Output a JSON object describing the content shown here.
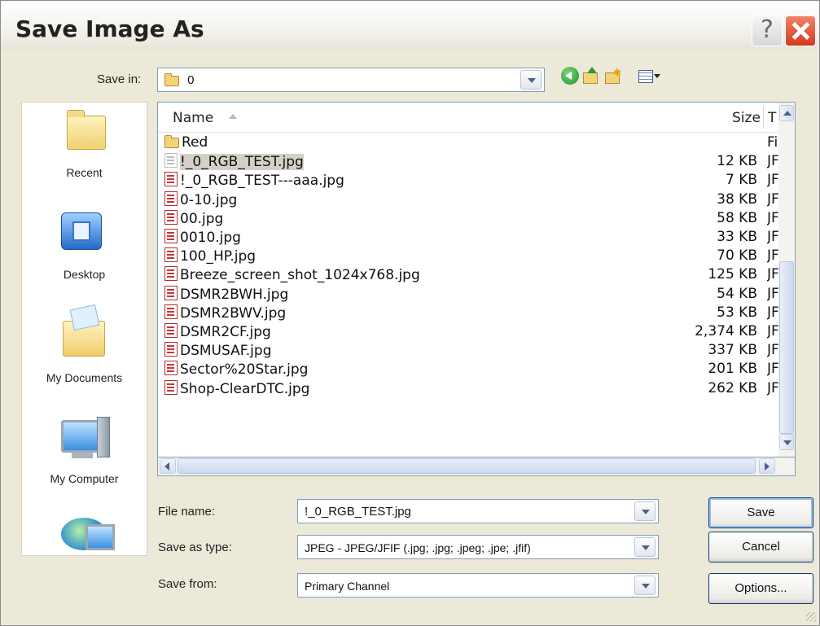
{
  "window": {
    "title": "Save Image As",
    "help_label": "?"
  },
  "save_in": {
    "label": "Save in:",
    "value": "0"
  },
  "toolbar": {
    "icons": [
      "back-icon",
      "up-folder-icon",
      "new-folder-icon",
      "views-menu-icon"
    ]
  },
  "places": [
    {
      "label": "Recent",
      "icon": "recent-folder-icon"
    },
    {
      "label": "Desktop",
      "icon": "desktop-icon"
    },
    {
      "label": "My Documents",
      "icon": "my-documents-icon"
    },
    {
      "label": "My Computer",
      "icon": "my-computer-icon"
    },
    {
      "label": "",
      "icon": "network-places-icon"
    }
  ],
  "file_list": {
    "columns": {
      "name": "Name",
      "size": "Size",
      "type": "T"
    },
    "rows": [
      {
        "name": "Red",
        "size": "",
        "type": "Fi",
        "kind": "folder"
      },
      {
        "name": "!_0_RGB_TEST.jpg",
        "size": "12 KB",
        "type": "JF",
        "kind": "jpg",
        "selected": true
      },
      {
        "name": "!_0_RGB_TEST---aaa.jpg",
        "size": "7 KB",
        "type": "JF",
        "kind": "jpg"
      },
      {
        "name": "0-10.jpg",
        "size": "38 KB",
        "type": "JF",
        "kind": "jpg"
      },
      {
        "name": "00.jpg",
        "size": "58 KB",
        "type": "JF",
        "kind": "jpg"
      },
      {
        "name": "0010.jpg",
        "size": "33 KB",
        "type": "JF",
        "kind": "jpg"
      },
      {
        "name": "100_HP.jpg",
        "size": "70 KB",
        "type": "JF",
        "kind": "jpg"
      },
      {
        "name": "Breeze_screen_shot_1024x768.jpg",
        "size": "125 KB",
        "type": "JF",
        "kind": "jpg"
      },
      {
        "name": "DSMR2BWH.jpg",
        "size": "54 KB",
        "type": "JF",
        "kind": "jpg"
      },
      {
        "name": "DSMR2BWV.jpg",
        "size": "53 KB",
        "type": "JF",
        "kind": "jpg"
      },
      {
        "name": "DSMR2CF.jpg",
        "size": "2,374 KB",
        "type": "JF",
        "kind": "jpg"
      },
      {
        "name": "DSMUSAF.jpg",
        "size": "337 KB",
        "type": "JF",
        "kind": "jpg"
      },
      {
        "name": "Sector%20Star.jpg",
        "size": "201 KB",
        "type": "JF",
        "kind": "jpg"
      },
      {
        "name": "Shop-ClearDTC.jpg",
        "size": "262 KB",
        "type": "JF",
        "kind": "jpg"
      }
    ]
  },
  "form": {
    "file_name_label": "File name:",
    "file_name_value": "!_0_RGB_TEST.jpg",
    "type_label": "Save as type:",
    "type_value": "JPEG - JPEG/JFIF (.jpg; .jpg; .jpeg; .jpe; .jfif)",
    "from_label": "Save from:",
    "from_value": "Primary Channel"
  },
  "buttons": {
    "save": "Save",
    "cancel": "Cancel",
    "options": "Options..."
  }
}
